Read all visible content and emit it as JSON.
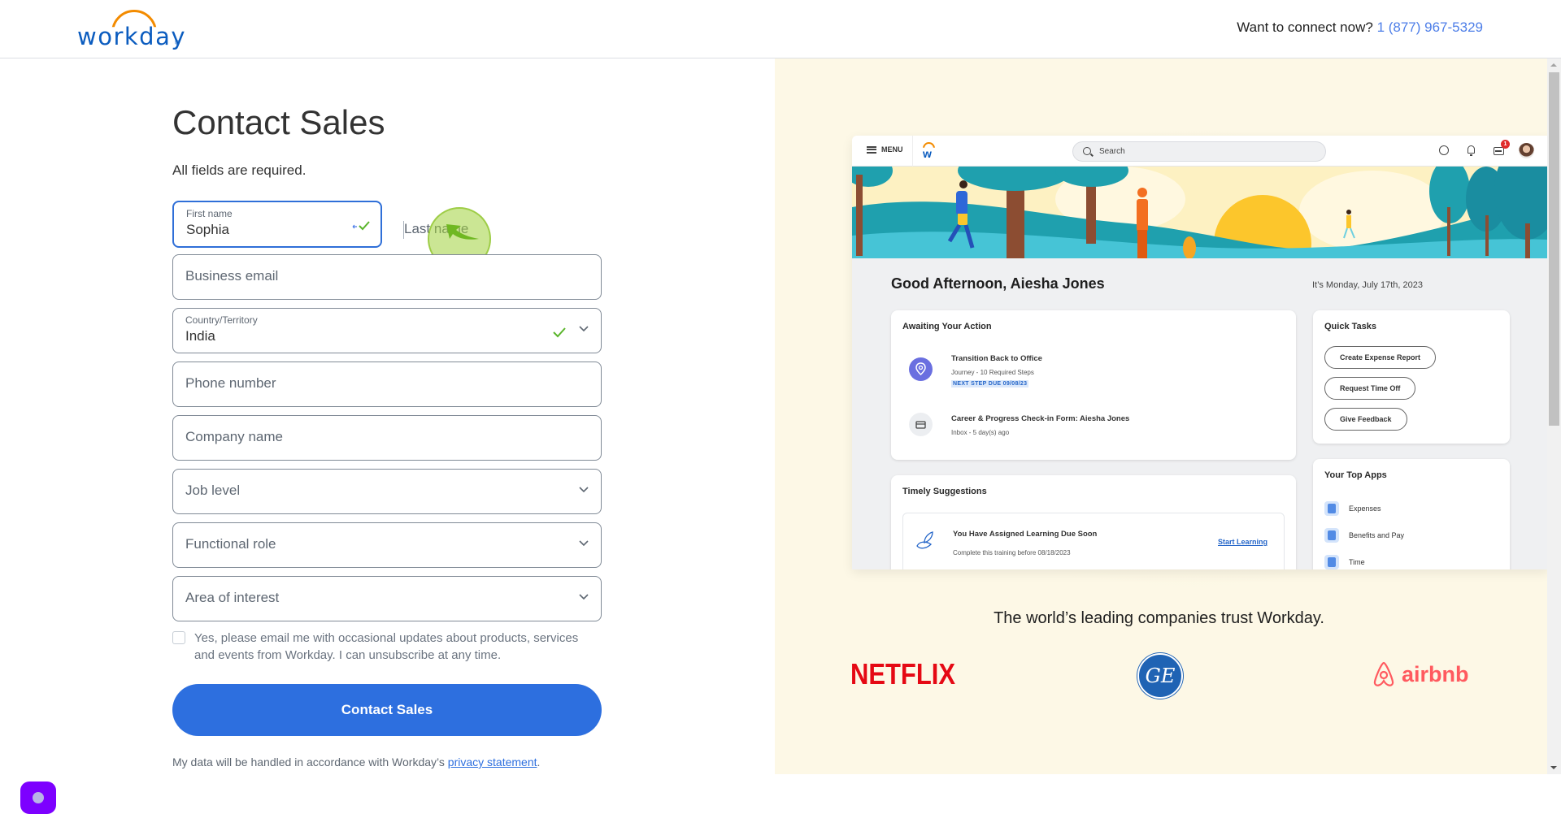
{
  "header": {
    "logo_text": "workday",
    "logo_reg": "®",
    "connect_prompt": "Want to connect now?",
    "phone": "1 (877) 967-5329"
  },
  "form": {
    "title": "Contact Sales",
    "required_note": "All fields are required.",
    "first_name": {
      "label": "First name",
      "value": "Sophia"
    },
    "last_name": {
      "placeholder": "Last name"
    },
    "business_email": {
      "placeholder": "Business email"
    },
    "country": {
      "label": "Country/Territory",
      "value": "India"
    },
    "phone_number": {
      "placeholder": "Phone number"
    },
    "company_name": {
      "placeholder": "Company name"
    },
    "job_level": {
      "placeholder": "Job level"
    },
    "functional_role": {
      "placeholder": "Functional role"
    },
    "area_of_interest": {
      "placeholder": "Area of interest"
    },
    "consent": {
      "text": "Yes, please email me with occasional updates about products, services and events from Workday. I can unsubscribe at any time.",
      "checked": false
    },
    "submit_label": "Contact Sales",
    "privacy_prefix": "My data will be handled in accordance with Workday’s ",
    "privacy_link": "privacy statement",
    "privacy_suffix": "."
  },
  "colors": {
    "brand_blue": "#0b5cbf",
    "brand_orange": "#f38b00",
    "button_blue": "#2d6fdf",
    "focus_border": "#2f6fd8",
    "valid_green": "#5ab52b",
    "panel_bg": "#fdf8e6",
    "chat_purple": "#7d00ff"
  },
  "mockup": {
    "menu_label": "MENU",
    "search_placeholder": "Search",
    "notification_count": "1",
    "greeting": "Good Afternoon, Aiesha Jones",
    "date": "It’s Monday, July 17th, 2023",
    "awaiting": {
      "title": "Awaiting Your Action",
      "items": [
        {
          "title": "Transition Back to Office",
          "subtitle": "Journey - 10 Required Steps",
          "tag": "NEXT STEP DUE 09/08/23",
          "icon": "location-pin-icon"
        },
        {
          "title": "Career & Progress Check-in Form: Aiesha Jones",
          "subtitle": "Inbox - 5 day(s) ago",
          "icon": "inbox-icon"
        }
      ]
    },
    "quick_tasks": {
      "title": "Quick Tasks",
      "buttons": [
        "Create Expense Report",
        "Request Time Off",
        "Give Feedback"
      ]
    },
    "timely": {
      "title": "Timely Suggestions",
      "item_title": "You Have Assigned Learning Due Soon",
      "item_subtitle": "Complete this training before 08/18/2023",
      "item_link": "Start Learning"
    },
    "top_apps": {
      "title": "Your Top Apps",
      "items": [
        "Expenses",
        "Benefits and Pay",
        "Time"
      ]
    }
  },
  "trust": {
    "headline": "The world’s leading companies trust Workday.",
    "logos": [
      "NETFLIX",
      "GE",
      "airbnb"
    ]
  }
}
